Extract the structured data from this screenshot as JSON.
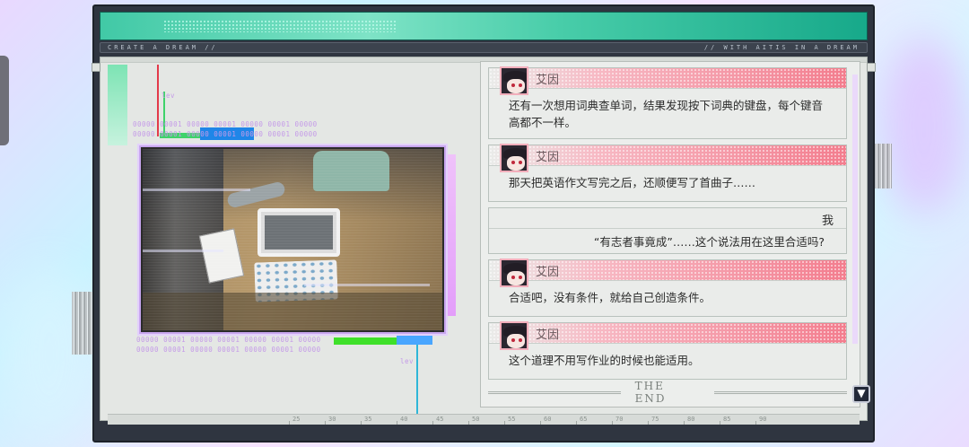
{
  "strip": {
    "left_text": "CREATE  A  DREAM //",
    "right_text": "// WITH  AITIS  IN  A  DREAM"
  },
  "binary": {
    "row1": "00000 00001 00000 00001 00000 00001 00000",
    "row2": "00000 00001 00000 00001 00000 00001 00000",
    "row3": "00000 00001 00000 00001 00000 00001 00000",
    "row4": "00000 00001 00000 00001 00000 00001 00000",
    "side": "lev"
  },
  "messages": [
    {
      "speaker": "艾因",
      "text": "还有一次想用词典查单词，结果发现按下词典的键盘，每个键音高都不一样。"
    },
    {
      "speaker": "艾因",
      "text": "那天把英语作文写完之后，还顺便写了首曲子……"
    },
    {
      "speaker": "我",
      "text": "“有志者事竟成”……这个说法用在这里合适吗?"
    },
    {
      "speaker": "艾因",
      "text": "合适吧，没有条件，就给自己创造条件。"
    },
    {
      "speaker": "艾因",
      "text": "这个道理不用写作业的时候也能适用。"
    }
  ],
  "end_label": "THE  END",
  "ruler_ticks": [
    "25",
    "30",
    "35",
    "40",
    "45",
    "50",
    "55",
    "60",
    "65",
    "70",
    "75",
    "80",
    "85",
    "90"
  ],
  "icons": {
    "scroll_down": "chevron-down-icon"
  },
  "colors": {
    "topbar": "#41c9a6",
    "name_bar": "#f37d8e",
    "frame": "#2f3540"
  }
}
